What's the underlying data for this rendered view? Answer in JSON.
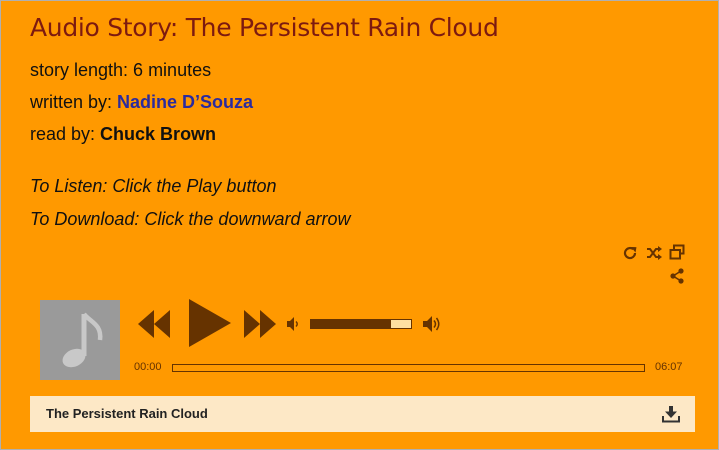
{
  "header": {
    "title": "Audio Story: The Persistent Rain Cloud",
    "length_label": "story length: 6 minutes",
    "author_prefix": "written by: ",
    "author_name": "Nadine D’Souza",
    "reader_prefix": "read by: ",
    "reader_name": "Chuck Brown"
  },
  "instructions": {
    "listen": "To Listen: Click the Play button",
    "download": "To Download: Click the downward arrow"
  },
  "player": {
    "toolbar_icons": [
      "repeat-icon",
      "shuffle-icon",
      "popout-icon",
      "share-icon"
    ],
    "album_art_icon": "music-note-icon",
    "current_time": "00:00",
    "duration": "06:07",
    "progress_fraction": 0,
    "volume_fraction": 0.8,
    "colors": {
      "background": "#ff9900",
      "controls": "#663300",
      "title": "#7d1a10",
      "author_link": "#2b2b9e",
      "track_bg": "#fde8c6"
    }
  },
  "playlist": {
    "items": [
      {
        "title": "The Persistent Rain Cloud",
        "action_icon": "download-icon"
      }
    ]
  }
}
